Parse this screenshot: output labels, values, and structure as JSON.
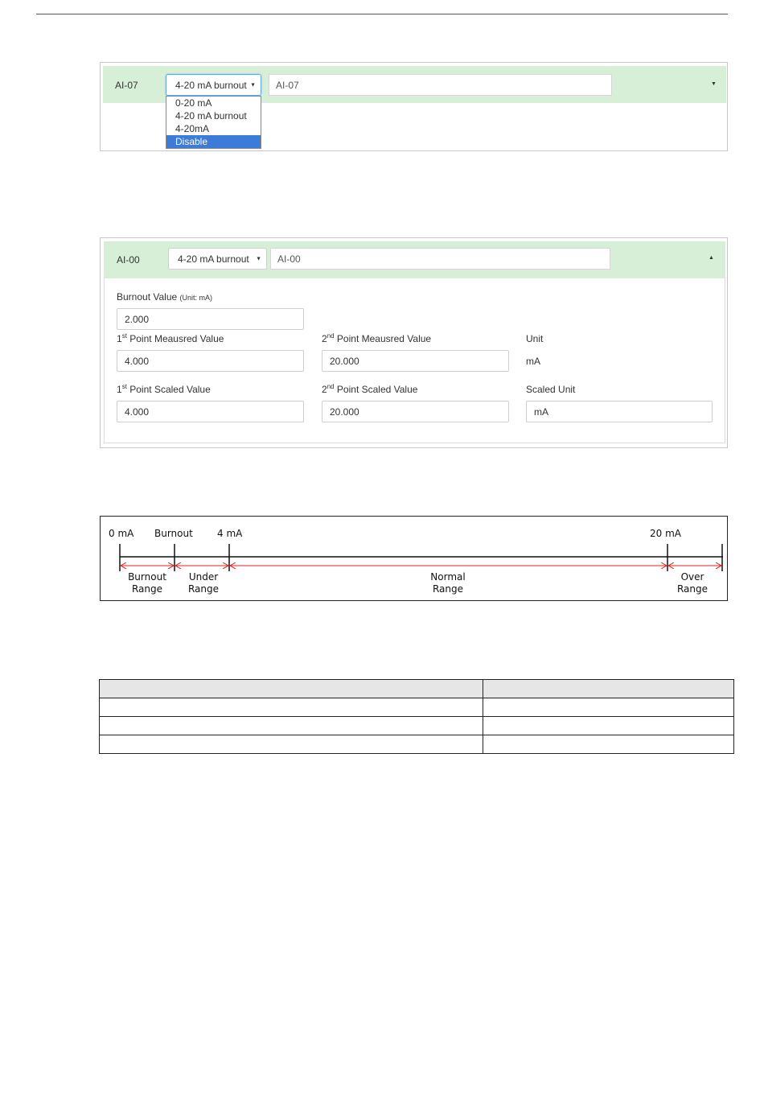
{
  "panel1": {
    "channel": "AI-07",
    "mode_select": {
      "value": "4-20 mA burnout"
    },
    "name_field": {
      "value": "AI-07"
    },
    "dropdown_options": [
      "0-20 mA",
      "4-20 mA burnout",
      "4-20mA",
      "Disable"
    ],
    "highlighted_option": "Disable"
  },
  "panel2": {
    "channel": "AI-00",
    "mode_select": {
      "value": "4-20 mA burnout"
    },
    "name_field": {
      "value": "AI-00"
    },
    "burnout": {
      "label": "Burnout Value",
      "unit_note": "(Unit: mA)",
      "value": "2.000"
    },
    "point1_measured": {
      "label_num": "1",
      "label_sup": "st",
      "label_rest": " Point Meausred Value",
      "value": "4.000"
    },
    "point2_measured": {
      "label_num": "2",
      "label_sup": "nd",
      "label_rest": " Point Meausred Value",
      "value": "20.000"
    },
    "unit": {
      "label": "Unit",
      "value": "mA"
    },
    "point1_scaled": {
      "label_num": "1",
      "label_sup": "st",
      "label_rest": " Point Scaled Value",
      "value": "4.000"
    },
    "point2_scaled": {
      "label_num": "2",
      "label_sup": "nd",
      "label_rest": " Point Scaled Value",
      "value": "20.000"
    },
    "scaled_unit": {
      "label": "Scaled Unit",
      "value": "mA"
    }
  },
  "diagram": {
    "ticks": [
      "0 mA",
      "Burnout",
      "4 mA",
      "20 mA"
    ],
    "ranges": [
      {
        "line1": "Burnout",
        "line2": "Range"
      },
      {
        "line1": "Under",
        "line2": "Range"
      },
      {
        "line1": "Normal",
        "line2": "Range"
      },
      {
        "line1": "Over",
        "line2": "Range"
      }
    ],
    "arrow_color": "#e02020",
    "axis_color": "#111111"
  },
  "table": {
    "rows": [
      [
        "",
        ""
      ],
      [
        "",
        ""
      ],
      [
        "",
        ""
      ]
    ]
  },
  "colors": {
    "header_green": "#d6efd6",
    "option_highlight": "#3d7bd9"
  }
}
